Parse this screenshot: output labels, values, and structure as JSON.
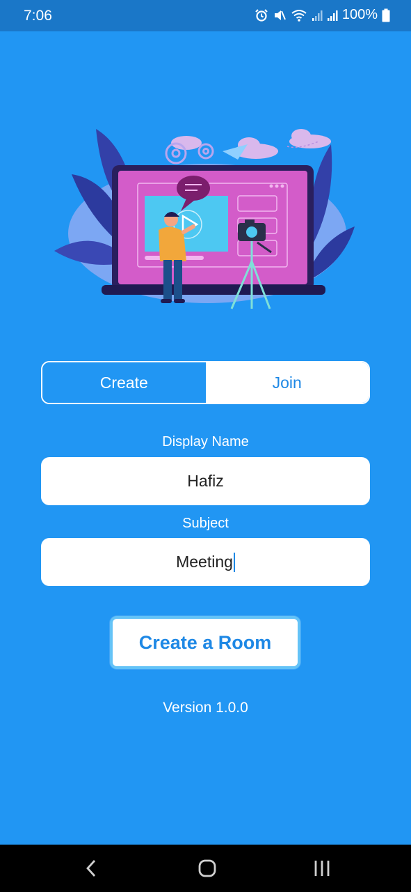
{
  "status_bar": {
    "time": "7:06",
    "battery": "100%",
    "icons": [
      "alarm-icon",
      "mute-icon",
      "wifi-icon",
      "signal-icon",
      "signal-icon",
      "battery-icon"
    ]
  },
  "tabs": {
    "create_label": "Create",
    "join_label": "Join",
    "active": "Create"
  },
  "form": {
    "display_name_label": "Display Name",
    "display_name_value": "Hafiz",
    "subject_label": "Subject",
    "subject_value": "Meeting"
  },
  "actions": {
    "create_room_label": "Create a Room"
  },
  "footer": {
    "version": "Version 1.0.0"
  },
  "nav": {
    "icons": [
      "back-icon",
      "home-icon",
      "recents-icon"
    ]
  },
  "colors": {
    "background": "#2196F3",
    "status_bar": "#1a77c8",
    "accent": "#1e88e5"
  }
}
